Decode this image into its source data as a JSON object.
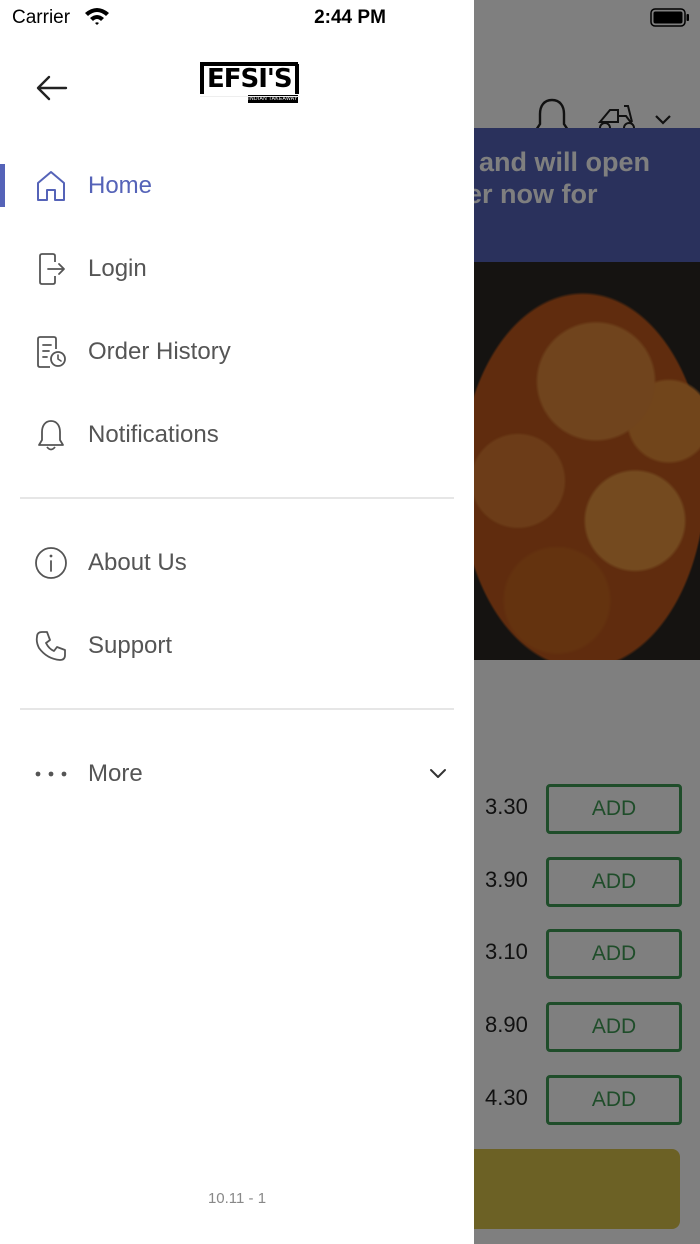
{
  "status_bar": {
    "carrier": "Carrier",
    "time": "2:44 PM"
  },
  "background": {
    "banner_lines": [
      "ed and will open",
      "rder now for"
    ],
    "prices": [
      "3.30",
      "3.90",
      "3.10",
      "8.90",
      "4.30"
    ],
    "add_label": "ADD",
    "header_icons": [
      "bell-icon",
      "scooter-icon",
      "chevron-down-icon"
    ]
  },
  "drawer": {
    "logo_text": "EFSI'S",
    "logo_subtext": "INDIAN TAKEAWAY",
    "menu_primary": [
      {
        "label": "Home",
        "icon": "home-icon",
        "active": true
      },
      {
        "label": "Login",
        "icon": "login-icon",
        "active": false
      },
      {
        "label": "Order History",
        "icon": "order-history-icon",
        "active": false
      },
      {
        "label": "Notifications",
        "icon": "bell-icon",
        "active": false
      }
    ],
    "menu_secondary": [
      {
        "label": "About Us",
        "icon": "info-icon"
      },
      {
        "label": "Support",
        "icon": "phone-icon"
      }
    ],
    "more": {
      "label": "More",
      "icon": "more-dots-icon"
    },
    "version": "10.11 - 1"
  },
  "colors": {
    "accent": "#5563b8",
    "add_green": "#3f9a54",
    "text_gray": "#555555"
  }
}
